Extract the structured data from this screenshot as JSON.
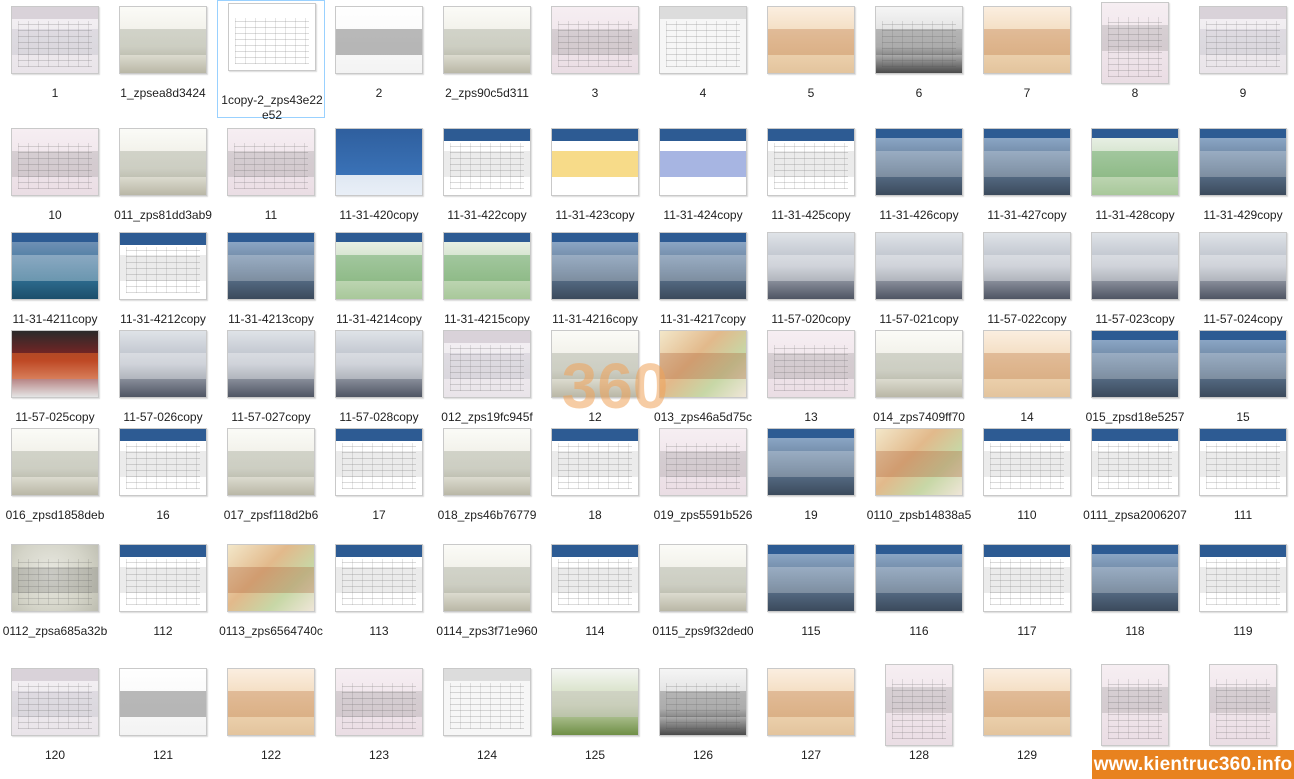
{
  "files": [
    {
      "name": "1",
      "style": "sheet"
    },
    {
      "name": "1_zpsea8d3424",
      "style": "sketch"
    },
    {
      "name": "1copy-2_zps43e22e52",
      "style": "doc",
      "selected": true
    },
    {
      "name": "2",
      "style": "title"
    },
    {
      "name": "2_zps90c5d311",
      "style": "sketch"
    },
    {
      "name": "3",
      "style": "plan"
    },
    {
      "name": "4",
      "style": "grid"
    },
    {
      "name": "5",
      "style": "render"
    },
    {
      "name": "6",
      "style": "sketchdark"
    },
    {
      "name": "7",
      "style": "render"
    },
    {
      "name": "8",
      "style": "plan",
      "portrait": true
    },
    {
      "name": "9",
      "style": "sheet"
    },
    {
      "name": "10",
      "style": "plan"
    },
    {
      "name": "011_zps81dd3ab9",
      "style": "sketch"
    },
    {
      "name": "11",
      "style": "plan"
    },
    {
      "name": "11-31-420copy",
      "style": "blue"
    },
    {
      "name": "11-31-422copy",
      "style": "slide"
    },
    {
      "name": "11-31-423copy",
      "style": "slideyellow"
    },
    {
      "name": "11-31-424copy",
      "style": "slidemap"
    },
    {
      "name": "11-31-425copy",
      "style": "slide"
    },
    {
      "name": "11-31-426copy",
      "style": "slidephoto"
    },
    {
      "name": "11-31-427copy",
      "style": "slidephoto"
    },
    {
      "name": "11-31-428copy",
      "style": "slidegreen"
    },
    {
      "name": "11-31-429copy",
      "style": "slidephoto"
    },
    {
      "name": "11-31-4211copy",
      "style": "slidepool"
    },
    {
      "name": "11-31-4212copy",
      "style": "slide"
    },
    {
      "name": "11-31-4213copy",
      "style": "slidephoto"
    },
    {
      "name": "11-31-4214copy",
      "style": "slidegreen"
    },
    {
      "name": "11-31-4215copy",
      "style": "slidegreen"
    },
    {
      "name": "11-31-4216copy",
      "style": "slidephoto"
    },
    {
      "name": "11-31-4217copy",
      "style": "slidephoto"
    },
    {
      "name": "11-57-020copy",
      "style": "gradient"
    },
    {
      "name": "11-57-021copy",
      "style": "gradient"
    },
    {
      "name": "11-57-022copy",
      "style": "gradient"
    },
    {
      "name": "11-57-023copy",
      "style": "gradient"
    },
    {
      "name": "11-57-024copy",
      "style": "gradient"
    },
    {
      "name": "11-57-025copy",
      "style": "gradientred"
    },
    {
      "name": "11-57-026copy",
      "style": "gradient"
    },
    {
      "name": "11-57-027copy",
      "style": "gradient"
    },
    {
      "name": "11-57-028copy",
      "style": "gradient"
    },
    {
      "name": "012_zps19fc945f",
      "style": "sheet"
    },
    {
      "name": "12",
      "style": "sketch"
    },
    {
      "name": "013_zps46a5d75c",
      "style": "colorsketch"
    },
    {
      "name": "13",
      "style": "plan"
    },
    {
      "name": "014_zps7409ff70",
      "style": "sketch"
    },
    {
      "name": "14",
      "style": "render"
    },
    {
      "name": "015_zpsd18e5257",
      "style": "slidephoto"
    },
    {
      "name": "15",
      "style": "slidephoto"
    },
    {
      "name": "016_zpsd1858deb",
      "style": "sketch"
    },
    {
      "name": "16",
      "style": "slide"
    },
    {
      "name": "017_zpsf118d2b6",
      "style": "sketch"
    },
    {
      "name": "17",
      "style": "slide"
    },
    {
      "name": "018_zps46b76779",
      "style": "sketch"
    },
    {
      "name": "18",
      "style": "slide"
    },
    {
      "name": "019_zps5591b526",
      "style": "plan"
    },
    {
      "name": "19",
      "style": "slidephoto"
    },
    {
      "name": "0110_zpsb14838a5",
      "style": "colorsketch"
    },
    {
      "name": "110",
      "style": "slide"
    },
    {
      "name": "0111_zpsa2006207",
      "style": "slide"
    },
    {
      "name": "111",
      "style": "slide"
    },
    {
      "name": "0112_zpsa685a32b",
      "style": "mapsketch"
    },
    {
      "name": "112",
      "style": "slide"
    },
    {
      "name": "0113_zps6564740c",
      "style": "colorsketch"
    },
    {
      "name": "113",
      "style": "slide"
    },
    {
      "name": "0114_zps3f71e960",
      "style": "sketch"
    },
    {
      "name": "114",
      "style": "slide"
    },
    {
      "name": "0115_zps9f32ded0",
      "style": "sketch"
    },
    {
      "name": "115",
      "style": "slidephoto"
    },
    {
      "name": "116",
      "style": "slidephoto"
    },
    {
      "name": "117",
      "style": "slide"
    },
    {
      "name": "118",
      "style": "slidephoto"
    },
    {
      "name": "119",
      "style": "slide"
    },
    {
      "name": "120",
      "style": "sheet"
    },
    {
      "name": "121",
      "style": "title"
    },
    {
      "name": "122",
      "style": "render"
    },
    {
      "name": "123",
      "style": "plan"
    },
    {
      "name": "124",
      "style": "grid"
    },
    {
      "name": "125",
      "style": "render3d"
    },
    {
      "name": "126",
      "style": "sketchdark"
    },
    {
      "name": "127",
      "style": "render"
    },
    {
      "name": "128",
      "style": "plan",
      "portrait": true
    },
    {
      "name": "129",
      "style": "render"
    },
    {
      "name": "",
      "style": "plan",
      "portrait": true
    },
    {
      "name": "",
      "style": "plan",
      "portrait": true
    }
  ],
  "watermark": {
    "logo_text": "360",
    "banner_text": "www.kientruc360.info"
  },
  "palette": {
    "orange": "#e8821f",
    "selection_border": "#99d1ff",
    "caption": "#1e1e1e"
  }
}
